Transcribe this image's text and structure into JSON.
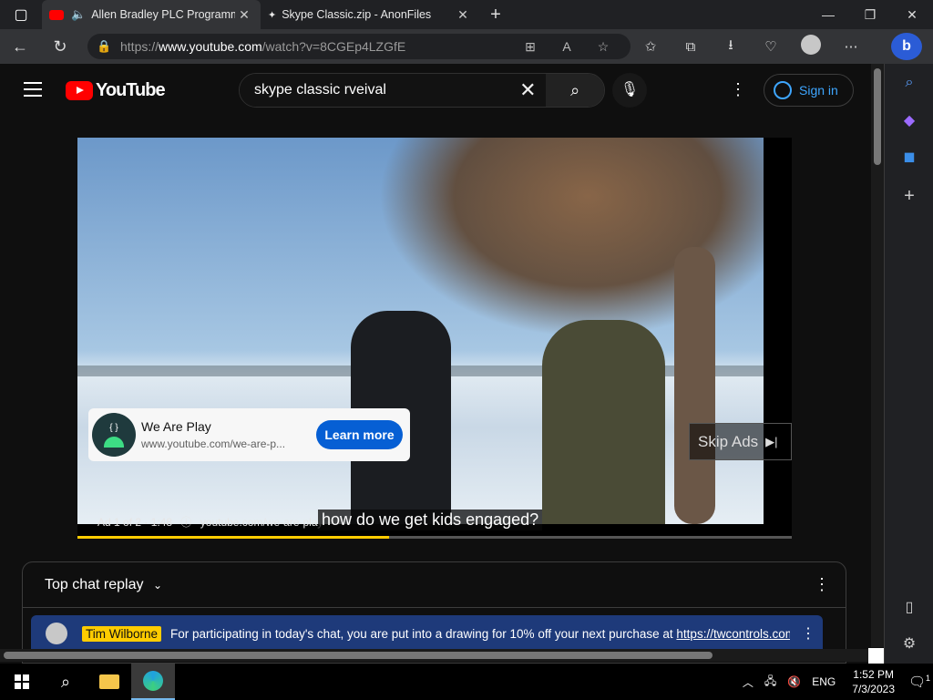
{
  "browser": {
    "tabs": [
      {
        "title": "Allen Bradley PLC Programming",
        "active": true
      },
      {
        "title": "Skype Classic.zip - AnonFiles",
        "active": false
      }
    ],
    "url_prefix": "https://",
    "url_host": "www.youtube.com",
    "url_path": "/watch?v=8CGEp4LZGfE"
  },
  "youtube": {
    "logo_text": "YouTube",
    "search_value": "skype classic rveival",
    "sign_in": "Sign in"
  },
  "video": {
    "ad_title": "We Are Play",
    "ad_url": "www.youtube.com/we-are-p...",
    "learn_more": "Learn more",
    "skip_label": "Skip Ads",
    "ad_info": "Ad 1 of 2 · 1:48",
    "ad_info_url": "youtube.com/we-are-play",
    "caption": "how do we get kids engaged?",
    "progress_fraction": 0.436
  },
  "chat": {
    "header": "Top chat replay",
    "pinned_author": "Tim Wilborne",
    "pinned_message": "For participating in today's chat, you are put into a drawing for 10% off your next purchase at ",
    "pinned_link": "https://twcontrols.com/..."
  },
  "taskbar": {
    "language": "ENG",
    "time": "1:52 PM",
    "date": "7/3/2023",
    "notification_count": "1"
  },
  "colors": {
    "yt_red": "#ff0000",
    "progress": "#ffcc00",
    "link_blue": "#3ea6ff",
    "learn_more_blue": "#065fd4",
    "pinned_bg": "#1e3a7a"
  }
}
